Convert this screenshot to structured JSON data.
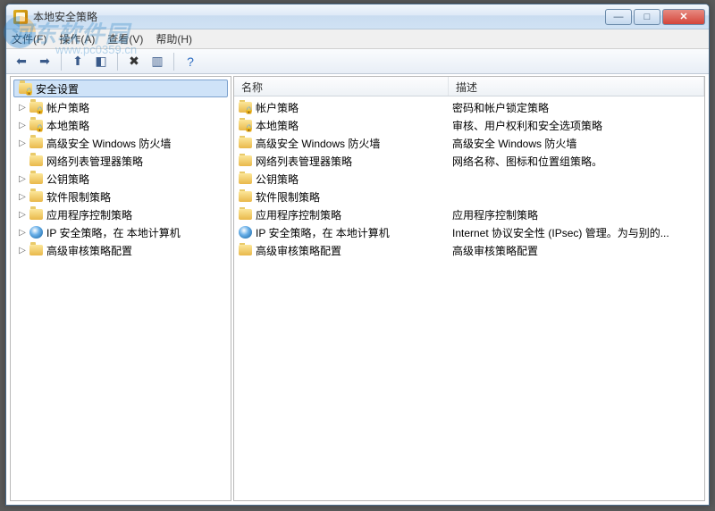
{
  "window": {
    "title": "本地安全策略"
  },
  "menu": {
    "file": "文件(F)",
    "action": "操作(A)",
    "view": "查看(V)",
    "help": "帮助(H)"
  },
  "watermark": {
    "text": "河东软件园",
    "url": "www.pc0359.cn"
  },
  "tree": {
    "root": "安全设置",
    "items": [
      {
        "label": "帐户策略",
        "expandable": true,
        "icon": "folder-lock"
      },
      {
        "label": "本地策略",
        "expandable": true,
        "icon": "folder-lock"
      },
      {
        "label": "高级安全 Windows 防火墙",
        "expandable": true,
        "icon": "folder"
      },
      {
        "label": "网络列表管理器策略",
        "expandable": false,
        "icon": "folder"
      },
      {
        "label": "公钥策略",
        "expandable": true,
        "icon": "folder"
      },
      {
        "label": "软件限制策略",
        "expandable": true,
        "icon": "folder"
      },
      {
        "label": "应用程序控制策略",
        "expandable": true,
        "icon": "folder"
      },
      {
        "label": "IP 安全策略，在 本地计算机",
        "expandable": true,
        "icon": "ip"
      },
      {
        "label": "高级审核策略配置",
        "expandable": true,
        "icon": "folder"
      }
    ]
  },
  "list": {
    "headers": {
      "name": "名称",
      "desc": "描述"
    },
    "rows": [
      {
        "name": "帐户策略",
        "desc": "密码和帐户锁定策略",
        "icon": "folder-lock"
      },
      {
        "name": "本地策略",
        "desc": "审核、用户权利和安全选项策略",
        "icon": "folder-lock"
      },
      {
        "name": "高级安全 Windows 防火墙",
        "desc": "高级安全 Windows 防火墙",
        "icon": "folder"
      },
      {
        "name": "网络列表管理器策略",
        "desc": "网络名称、图标和位置组策略。",
        "icon": "folder"
      },
      {
        "name": "公钥策略",
        "desc": "",
        "icon": "folder"
      },
      {
        "name": "软件限制策略",
        "desc": "",
        "icon": "folder"
      },
      {
        "name": "应用程序控制策略",
        "desc": "应用程序控制策略",
        "icon": "folder"
      },
      {
        "name": "IP 安全策略，在 本地计算机",
        "desc": "Internet 协议安全性 (IPsec) 管理。为与别的...",
        "icon": "ip"
      },
      {
        "name": "高级审核策略配置",
        "desc": "高级审核策略配置",
        "icon": "folder"
      }
    ]
  }
}
